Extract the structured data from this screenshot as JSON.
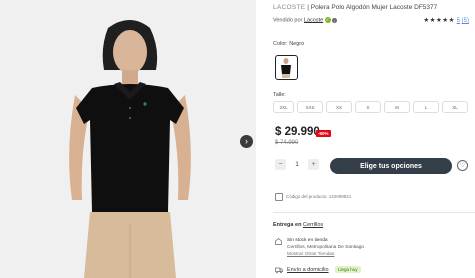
{
  "product": {
    "brand": "LACOSTE",
    "separator": "|",
    "title": "Polera Polo Algodón Mujer Lacoste DF5377",
    "seller_prefix": "Vendido por",
    "seller_name": "Lacoste",
    "rating_stars": "★★★★★",
    "rating_value": "5",
    "reviews": "(5)"
  },
  "color": {
    "label": "Color: Negro",
    "swatch_color": "#000000"
  },
  "sizes": {
    "label": "Talle:",
    "options": [
      "2XL",
      "XXS",
      "XS",
      "S",
      "M",
      "L",
      "XL"
    ]
  },
  "pricing": {
    "price": "$ 29.990",
    "discount_badge": "-60%",
    "old_price": "$ 74.990"
  },
  "quantity": {
    "minus": "−",
    "value": "1",
    "plus": "+"
  },
  "cta": {
    "label": "Elige tus opciones"
  },
  "product_code": "Código del producto: 142099821",
  "delivery": {
    "title_prefix": "Entrega en",
    "city": "Cerrillos",
    "store_title": "Sin stock en tienda",
    "store_location": "Cerrillos, Metropolitana De Santiago",
    "store_more": "Mostrar Otras Tiendas",
    "shipping_label": "Envío a domicilio",
    "shipping_badge": "Llega hoy"
  },
  "colors": {
    "cta_bg": "#343e48",
    "discount": "#e30613",
    "stars": "#333333"
  },
  "icons": [
    "chevron-right-icon",
    "verified-check-icon",
    "info-icon",
    "heart-icon",
    "barcode-icon",
    "store-icon",
    "truck-icon"
  ]
}
